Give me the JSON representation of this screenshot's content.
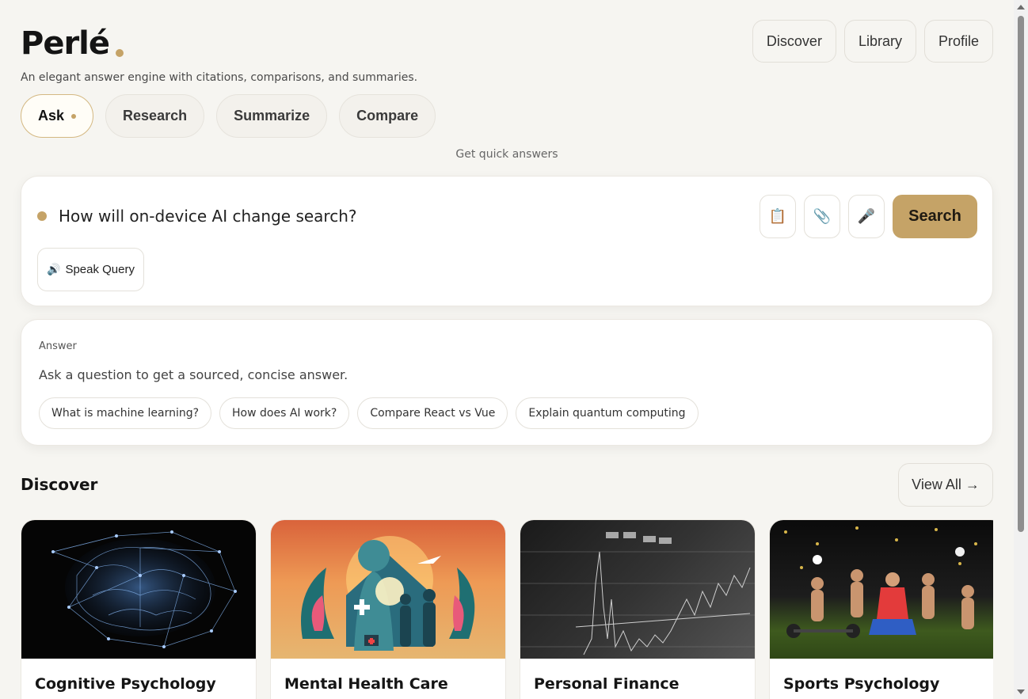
{
  "brand": {
    "title": "Perlé",
    "tagline": "An elegant answer engine with citations, comparisons, and summaries.",
    "accent": "#c5a367"
  },
  "topnav": [
    {
      "label": "Discover"
    },
    {
      "label": "Library"
    },
    {
      "label": "Profile"
    }
  ],
  "modes": [
    {
      "label": "Ask",
      "active": true
    },
    {
      "label": "Research"
    },
    {
      "label": "Summarize"
    },
    {
      "label": "Compare"
    }
  ],
  "mode_hint": "Get quick answers",
  "search": {
    "value": "How will on-device AI change search?",
    "button_label": "Search",
    "speak_label": "Speak Query",
    "tools": [
      {
        "icon": "clipboard-icon",
        "glyph": "📋"
      },
      {
        "icon": "paperclip-icon",
        "glyph": "📎"
      },
      {
        "icon": "microphone-icon",
        "glyph": "🎤"
      }
    ],
    "speak_glyph": "🔊"
  },
  "answer": {
    "label": "Answer",
    "placeholder": "Ask a question to get a sourced, concise answer.",
    "suggestions": [
      "What is machine learning?",
      "How does AI work?",
      "Compare React vs Vue",
      "Explain quantum computing"
    ]
  },
  "discover": {
    "title": "Discover",
    "view_all": "View All →",
    "cards": [
      {
        "title": "Cognitive Psychology",
        "image": "brain-network"
      },
      {
        "title": "Mental Health Care",
        "image": "care-illustration"
      },
      {
        "title": "Personal Finance",
        "image": "stock-chart"
      },
      {
        "title": "Sports Psychology",
        "image": "athletes"
      }
    ]
  }
}
